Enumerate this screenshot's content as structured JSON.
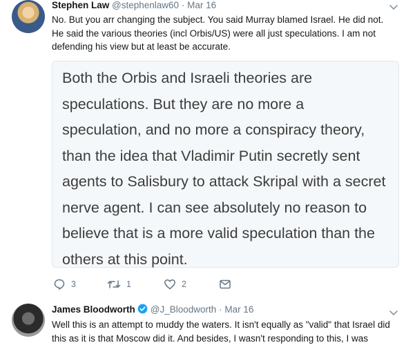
{
  "tweets": [
    {
      "name": "Stephen Law",
      "handle": "@stephenlaw60",
      "dot": "·",
      "date": "Mar 16",
      "text": "No. But you arr changing the subject. You said Murray blamed Israel. He did not. He said the various theories (incl Orbis/US) were all just speculations. I am not defending his view but at least be accurate.",
      "quote": "Both the Orbis and Israeli theories are speculations. But they are no more a speculation, and no more a conspiracy theory, than the idea that Vladimir Putin secretly sent agents to Salisbury to attack Skripal with a secret nerve agent. I can see absolutely no reason to believe that is a more valid speculation than the others at this point.",
      "actions": {
        "replies": "3",
        "retweets": "1",
        "likes": "2"
      }
    },
    {
      "name": "James Bloodworth",
      "verified": true,
      "handle": "@J_Bloodworth",
      "dot": "·",
      "date": "Mar 16",
      "text": "Well this is an attempt to muddy the waters. It isn't equally as \"valid\" that Israel did this as it is that Moscow did it. And besides, I wasn't responding to this, I was"
    }
  ],
  "colors": {
    "text": "#14171a",
    "muted": "#657786",
    "verified": "#1da1f2",
    "border": "#e1e8ed"
  }
}
